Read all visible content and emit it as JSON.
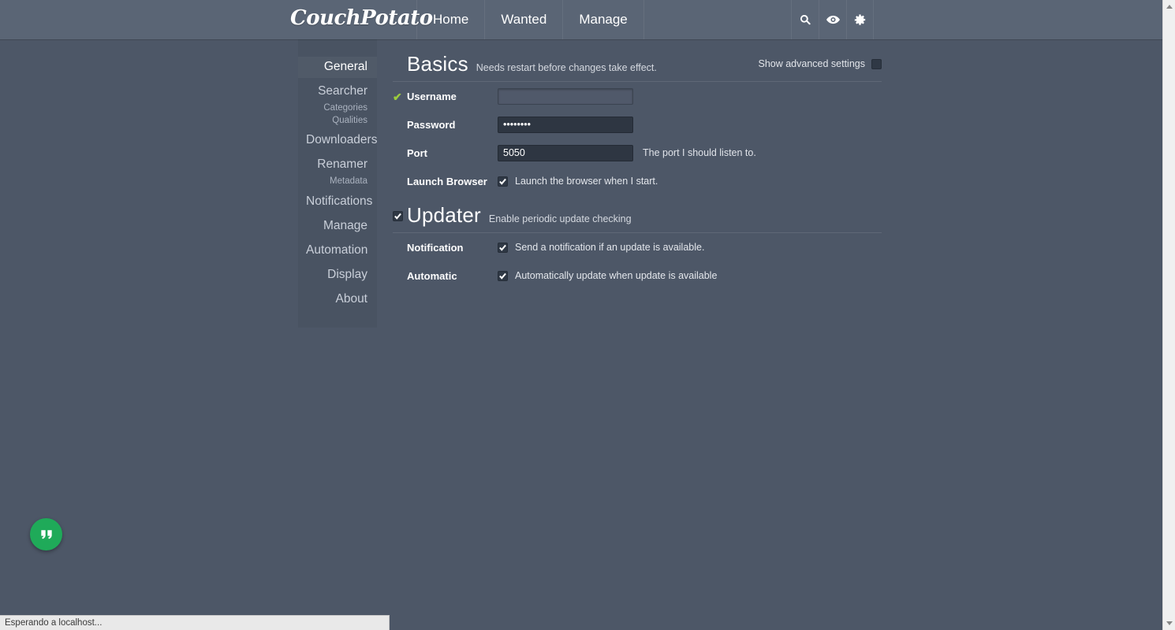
{
  "navbar": {
    "brand": "CouchPotato",
    "links": [
      {
        "label": "Home",
        "name": "nav-link-home"
      },
      {
        "label": "Wanted",
        "name": "nav-link-wanted"
      },
      {
        "label": "Manage",
        "name": "nav-link-manage"
      }
    ],
    "icons": [
      {
        "name": "search-icon"
      },
      {
        "name": "eye-icon"
      },
      {
        "name": "gear-icon"
      }
    ]
  },
  "sidebar": {
    "items": [
      {
        "label": "General",
        "active": true,
        "subs": []
      },
      {
        "label": "Searcher",
        "active": false,
        "subs": [
          "Categories",
          "Qualities"
        ]
      },
      {
        "label": "Downloaders",
        "active": false,
        "subs": []
      },
      {
        "label": "Renamer",
        "active": false,
        "subs": [
          "Metadata"
        ]
      },
      {
        "label": "Notifications",
        "active": false,
        "subs": []
      },
      {
        "label": "Manage",
        "active": false,
        "subs": []
      },
      {
        "label": "Automation",
        "active": false,
        "subs": []
      },
      {
        "label": "Display",
        "active": false,
        "subs": []
      },
      {
        "label": "About",
        "active": false,
        "subs": []
      }
    ]
  },
  "basics": {
    "title": "Basics",
    "subtitle": "Needs restart before changes take effect.",
    "advanced_label": "Show advanced settings",
    "advanced_checked": false,
    "username": {
      "label": "Username",
      "value": "",
      "placeholder": "",
      "valid": true
    },
    "password": {
      "label": "Password",
      "value": "••••••••",
      "placeholder": ""
    },
    "port": {
      "label": "Port",
      "value": "5050",
      "placeholder": "",
      "hint": "The port I should listen to."
    },
    "launch_browser": {
      "label": "Launch Browser",
      "checkbox_label": "Launch the browser when I start.",
      "checked": true
    }
  },
  "updater": {
    "title": "Updater",
    "subtitle": "Enable periodic update checking",
    "enabled": true,
    "notification": {
      "label": "Notification",
      "checkbox_label": "Send a notification if an update is available.",
      "checked": true
    },
    "automatic": {
      "label": "Automatic",
      "checkbox_label": "Automatically update when update is available",
      "checked": true
    }
  },
  "fab": {
    "name": "chat-quote-icon"
  },
  "statusbar": {
    "text": "Esperando a localhost..."
  },
  "colors": {
    "header_bg": "#5a6575",
    "body_bg": "#4d5767",
    "input_bg": "#2e3642",
    "input_focus_bg": "#50596a",
    "accent_green": "#9ccc3c",
    "fab_green": "#1faa59",
    "text": "#ffffff"
  }
}
